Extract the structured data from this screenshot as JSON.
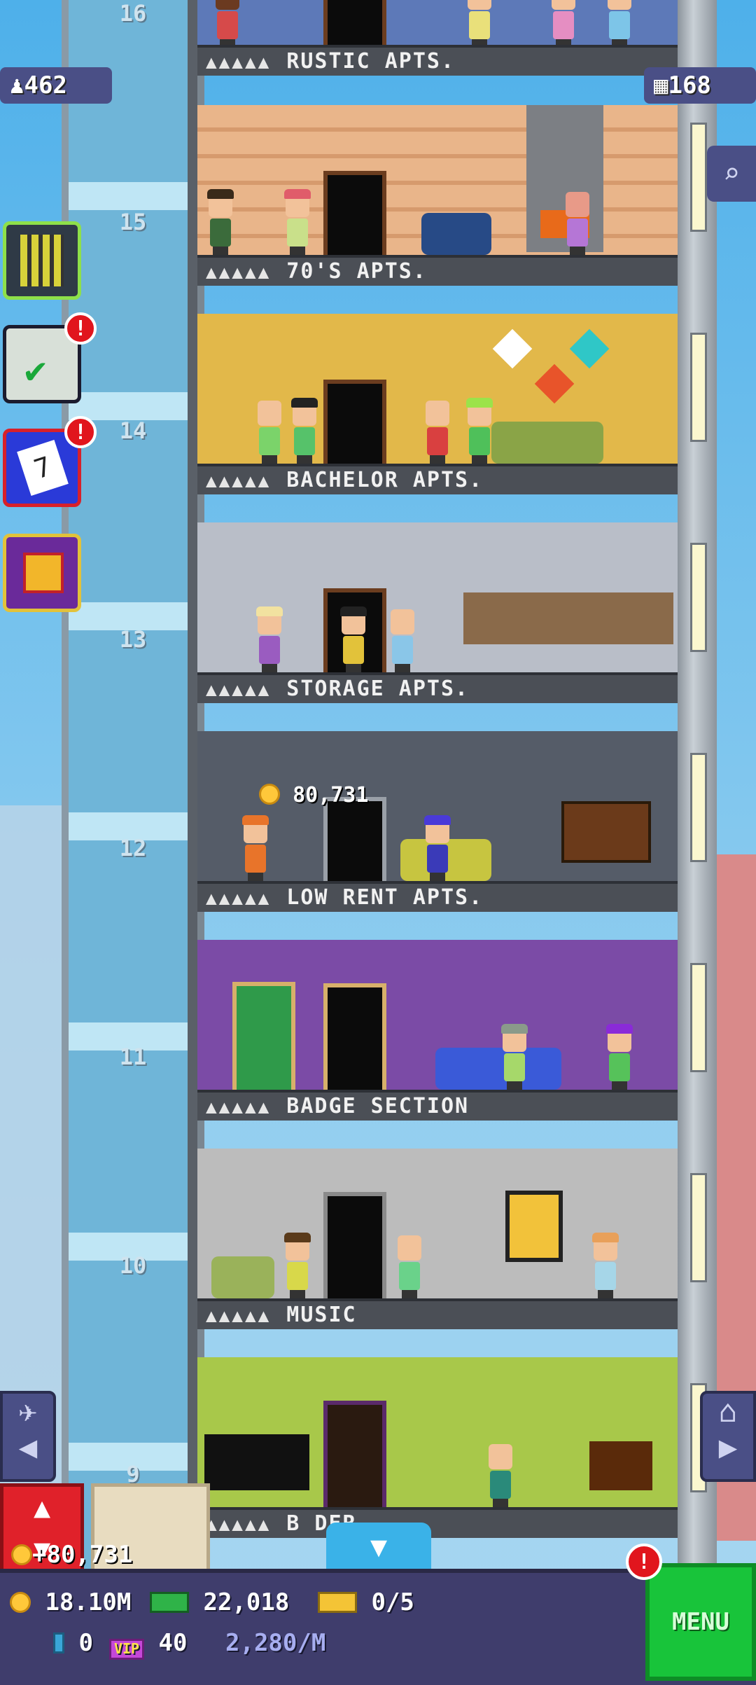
{
  "status": {
    "population": "462",
    "floors_count": "168"
  },
  "elevator": {
    "floor_numbers": [
      "16",
      "15",
      "14",
      "13",
      "12",
      "11",
      "10",
      "9"
    ]
  },
  "floors": [
    {
      "name": "RUSTIC APTS.",
      "dots": "▲▲▲▲▲"
    },
    {
      "name": "70'S APTS.",
      "dots": "▲▲▲▲▲"
    },
    {
      "name": "BACHELOR APTS.",
      "dots": "▲▲▲▲▲"
    },
    {
      "name": "STORAGE APTS.",
      "dots": "▲▲▲▲▲"
    },
    {
      "name": "LOW RENT APTS.",
      "dots": "▲▲▲▲▲"
    },
    {
      "name": "BADGE SECTION",
      "dots": "▲▲▲▲▲"
    },
    {
      "name": "MUSIC",
      "dots": "▲▲▲▲▲"
    },
    {
      "name": "B      DER",
      "dots": "▲▲▲▲▲"
    }
  ],
  "floating_coins": "80,731",
  "elevator_coins": "+80,731",
  "notifications": {
    "missions": "!",
    "calendar": "!",
    "menu": "!"
  },
  "calendar_day": "7",
  "bottom": {
    "coins": "18.10M",
    "cash": "22,018",
    "tickets": "0/5",
    "bux": "0",
    "vip": "40",
    "rate": "2,280/M",
    "menu_label": "MENU",
    "vip_icon_text": "VIP"
  },
  "colors": {
    "menu_green": "#18c43a",
    "notification_red": "#e1151d",
    "bar_purple": "#3f3d6c"
  }
}
